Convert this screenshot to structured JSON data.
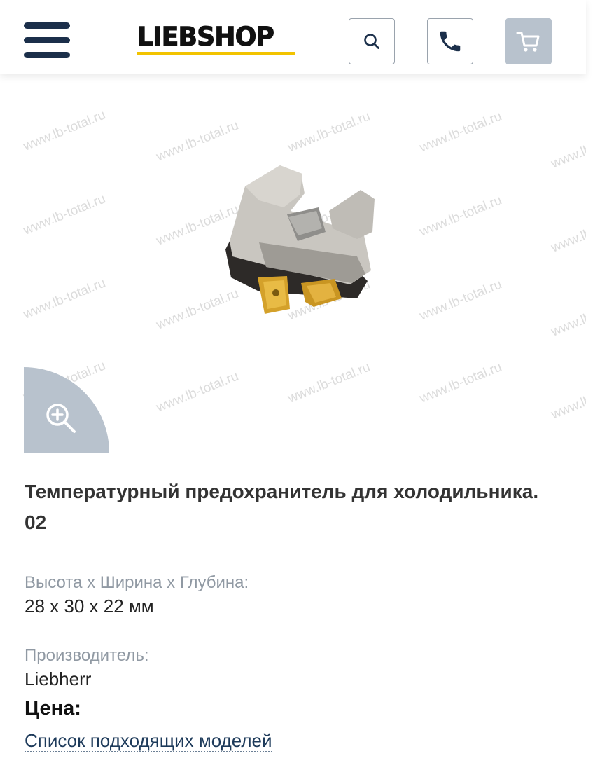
{
  "header": {
    "logo_text": "LIEBSHOP",
    "icons": {
      "menu": "hamburger-menu-icon",
      "search": "search-icon",
      "phone": "phone-icon",
      "cart": "cart-icon"
    }
  },
  "gallery": {
    "watermark": "www.lb-total.ru",
    "zoom_icon": "zoom-in-icon"
  },
  "product": {
    "title": "Температурный предохранитель для холодильника. 02",
    "dimensions_label": "Высота x Ширина x Глубина:",
    "dimensions_value": "28 x 30 x 22 мм",
    "manufacturer_label": "Производитель:",
    "manufacturer_value": "Liebherr",
    "price_label": "Цена:",
    "models_link": "Список подходящих моделей"
  },
  "colors": {
    "brand_dark": "#1b2f4a",
    "brand_yellow": "#f2c300",
    "cart_bg": "#b8c2cd",
    "muted_text": "#9099a3"
  }
}
